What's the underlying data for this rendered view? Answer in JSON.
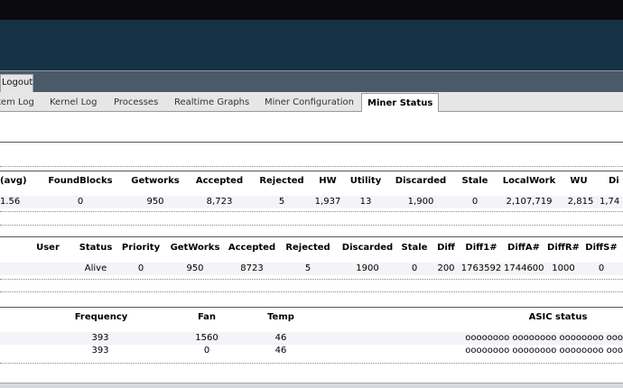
{
  "window": {
    "logout_label": "Logout"
  },
  "tabs": [
    "tem Log",
    "Kernel Log",
    "Processes",
    "Realtime Graphs",
    "Miner Configuration",
    "Miner Status"
  ],
  "summary": {
    "headers": [
      "(avg)",
      "FoundBlocks",
      "Getworks",
      "Accepted",
      "Rejected",
      "HW",
      "Utility",
      "Discarded",
      "Stale",
      "LocalWork",
      "WU",
      "Di"
    ],
    "row": [
      "1.56",
      "0",
      "950",
      "8,723",
      "5",
      "1,937",
      "13",
      "1,900",
      "0",
      "2,107,719",
      "2,815",
      "1,74"
    ]
  },
  "pools": {
    "headers": [
      "User",
      "Status",
      "Priority",
      "GetWorks",
      "Accepted",
      "Rejected",
      "Discarded",
      "Stale",
      "Diff",
      "Diff1#",
      "DiffA#",
      "DiffR#",
      "DiffS#"
    ],
    "row": [
      "",
      "Alive",
      "0",
      "950",
      "8723",
      "5",
      "1900",
      "0",
      "200",
      "1763592",
      "1744600",
      "1000",
      "0"
    ]
  },
  "devices": {
    "headers": [
      "Frequency",
      "Fan",
      "Temp",
      "ASIC status"
    ],
    "rows": [
      [
        "393",
        "1560",
        "46",
        "oooooooo oooooooo oooooooo ooo"
      ],
      [
        "393",
        "0",
        "46",
        "oooooooo oooooooo oooooooo ooo"
      ]
    ]
  }
}
